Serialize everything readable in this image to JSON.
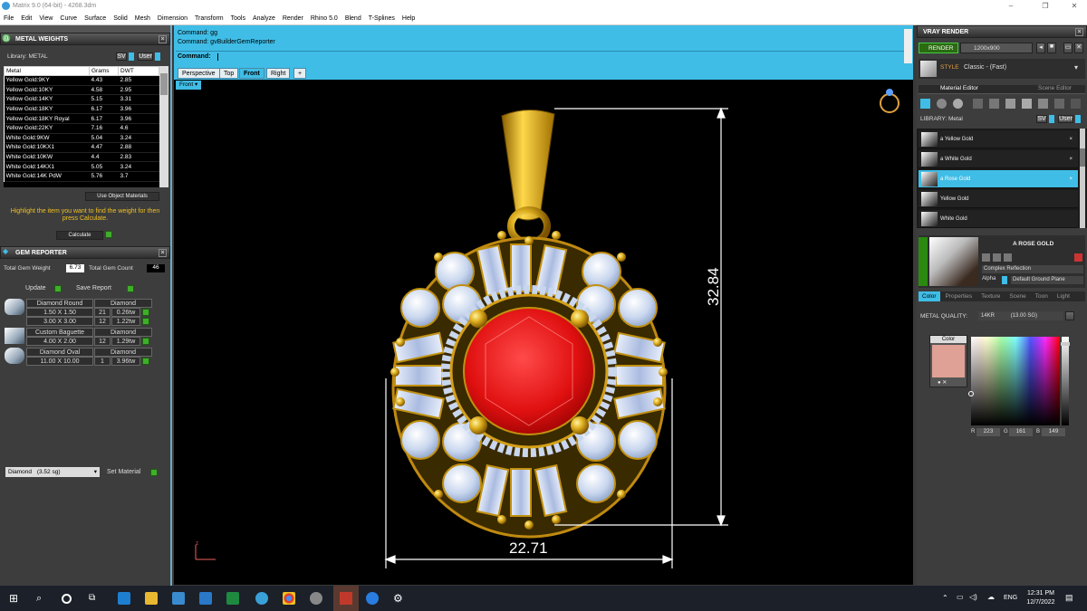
{
  "window": {
    "title": "Matrix 9.0 (64-bit) - 4268.3dm",
    "controls": [
      "–",
      "❐",
      "✕"
    ]
  },
  "menu": [
    "File",
    "Edit",
    "View",
    "Curve",
    "Surface",
    "Solid",
    "Mesh",
    "Dimension",
    "Transform",
    "Tools",
    "Analyze",
    "Render",
    "Rhino 5.0",
    "Blend",
    "T-Splines",
    "Help"
  ],
  "metal_weights": {
    "title": "METAL WEIGHTS",
    "library_label": "Library: METAL",
    "btn_sv": "SV",
    "btn_user": "User",
    "headers": [
      "Metal",
      "Grams",
      "DWT"
    ],
    "rows": [
      [
        "Yellow Gold:9KY",
        "4.43",
        "2.85"
      ],
      [
        "Yellow Gold:10KY",
        "4.58",
        "2.95"
      ],
      [
        "Yellow Gold:14KY",
        "5.15",
        "3.31"
      ],
      [
        "Yellow Gold:18KY",
        "6.17",
        "3.96"
      ],
      [
        "Yellow Gold:18KY Royal",
        "6.17",
        "3.96"
      ],
      [
        "Yellow Gold:22KY",
        "7.16",
        "4.6"
      ],
      [
        "White Gold:9KW",
        "5.04",
        "3.24"
      ],
      [
        "White Gold:10KX1",
        "4.47",
        "2.88"
      ],
      [
        "White Gold:10KW",
        "4.4",
        "2.83"
      ],
      [
        "White Gold:14KX1",
        "5.05",
        "3.24"
      ],
      [
        "White Gold:14K PdW",
        "5.76",
        "3.7"
      ]
    ],
    "use_object_materials": "Use Object Materials",
    "instruction": "Highlight the item you want to find the weight for then press Calculate.",
    "calculate": "Calculate"
  },
  "gem_reporter": {
    "title": "GEM REPORTER",
    "total_weight_label": "Total Gem Weight",
    "total_weight": "6.73",
    "total_count_label": "Total Gem Count",
    "total_count": "46",
    "update": "Update",
    "save_report": "Save Report",
    "groups": [
      {
        "name": "Diamond Round",
        "material": "Diamond",
        "rows": [
          [
            "1.50 X 1.50",
            "21",
            "0.26tw"
          ],
          [
            "3.00 X 3.00",
            "12",
            "1.22tw"
          ]
        ]
      },
      {
        "name": "Custom Baguette",
        "material": "Diamond",
        "rows": [
          [
            "4.00 X 2.00",
            "12",
            "1.29tw"
          ]
        ]
      },
      {
        "name": "Diamond Oval",
        "material": "Diamond",
        "rows": [
          [
            "11.00 X 10.00",
            "1",
            "3.96tw"
          ]
        ]
      }
    ],
    "material_select": "Diamond",
    "material_sg": "(3.52 sg)",
    "set_material": "Set Material"
  },
  "command": {
    "line1": "Command: gg",
    "line2": "Command: gvBuilderGemReporter",
    "prompt": "Command:"
  },
  "viewport": {
    "tabs": [
      "Perspective",
      "Top",
      "Front",
      "Right",
      "+"
    ],
    "active_tab": "Front",
    "view_label": "Front",
    "dim_height": "32.84",
    "dim_width": "22.71",
    "axis_label": "z"
  },
  "vray": {
    "title": "VRAY RENDER",
    "render_btn": "RENDER",
    "resolution": "1200x900",
    "style_label": "STYLE",
    "style_value": "Classic - (Fast)",
    "tabs": [
      "Material Editor",
      "Scene Editor"
    ],
    "library_label": "LIBRARY: Metal",
    "btn_sv": "SV",
    "btn_user": "User",
    "materials": [
      "a Yellow Gold",
      "a White Gold",
      "a Rose Gold",
      "Yellow Gold",
      "White Gold"
    ],
    "selected_material": "a Rose Gold",
    "preview_title": "A ROSE GOLD",
    "reflection": "Complex Reflection",
    "alpha": "Alpha",
    "ground": "Default Ground Plane",
    "prop_tabs": [
      "Color",
      "Properties",
      "Texture",
      "Scene",
      "Toon",
      "Light"
    ],
    "metal_quality_label": "METAL QUALITY:",
    "metal_quality": "14KR",
    "metal_quality_sg": "(13.00 SG)",
    "color_label": "Color",
    "rgb": [
      "223",
      "161",
      "149"
    ],
    "swatch": "#df a195"
  },
  "taskbar": {
    "lang": "ENG",
    "time": "12:31 PM",
    "date": "12/7/2022"
  },
  "colors": {
    "accent": "#3fbde6",
    "gold": "#e0b020",
    "ruby": "#e01010",
    "rose_swatch": "#dfa195"
  }
}
